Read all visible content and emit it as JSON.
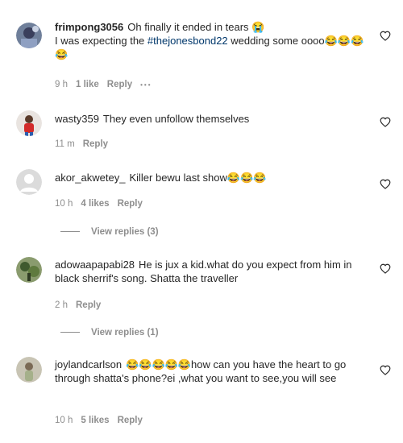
{
  "comments": [
    {
      "username": "frimpong3056",
      "text_before": "Oh finally it ended in tears 😭",
      "text_line2_prefix": "I was expecting the ",
      "hashtag": "#thejonesbond22",
      "text_after": " wedding some oooo😂😂😂😂",
      "time": "9 h",
      "likes": "1 like",
      "reply": "Reply",
      "more": "•••"
    },
    {
      "username": "wasty359",
      "text": "They even unfollow themselves",
      "time": "11 m",
      "reply": "Reply"
    },
    {
      "username": "akor_akwetey_",
      "text": "Killer bewu last show😂😂😂",
      "time": "10 h",
      "likes": "4 likes",
      "reply": "Reply",
      "view_replies": "View replies (3)"
    },
    {
      "username": "adowaapapabi28",
      "text": "He is jux a kid.what do you expect from him in black sherrif's song. Shatta the traveller",
      "time": "2 h",
      "reply": "Reply",
      "view_replies": "View replies (1)"
    },
    {
      "username": "joylandcarlson",
      "text": "😂😂😂😂😂how can you have the heart to go through shatta's phone?ei ,what you want to see,you will see",
      "time": "10 h",
      "likes": "5 likes",
      "reply": "Reply"
    }
  ],
  "colors": {
    "text": "#262626",
    "muted": "#8e8e8e",
    "hashtag": "#00376b"
  },
  "icons": [
    "heart-outline-icon",
    "avatar"
  ]
}
